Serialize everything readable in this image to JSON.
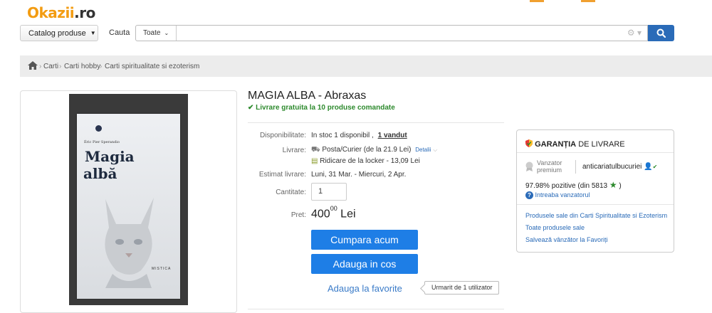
{
  "header": {
    "logo_ok": "Okazii",
    "logo_rest": ".ro",
    "catalog_label": "Catalog produse",
    "search_label": "Cauta",
    "search_category": "Toate",
    "search_value": ""
  },
  "breadcrumb": {
    "items": [
      "Carti",
      "Carti hobby",
      "Carti spiritualitate si ezoterism"
    ]
  },
  "product": {
    "title": "MAGIA ALBA - Abraxas",
    "free_shipping": "Livrare gratuita la 10 produse comandate",
    "availability_label": "Disponibilitate:",
    "availability_value": "In stoc 1 disponibil ,",
    "sold": "1 vandut",
    "delivery_label": "Livrare:",
    "delivery_option1": "Posta/Curier (de la 21.9 Lei)",
    "delivery_details": "Detalii",
    "delivery_option2": "Ridicare de la locker - 13,09 Lei",
    "estimate_label": "Estimat livrare:",
    "estimate_value": "Luni, 31 Mar. - Miercuri, 2 Apr.",
    "quantity_label": "Cantitate:",
    "quantity_value": "1",
    "price_label": "Pret:",
    "price_main": "400",
    "price_cents": "00",
    "price_currency": "Lei",
    "buy_button": "Cumpara acum",
    "cart_button": "Adauga in cos",
    "favorite_link": "Adauga  la favorite",
    "followers": "Urmarit de 1 utilizator"
  },
  "book_cover": {
    "author": "Éric Pier Sperandio",
    "title_line1": "Magia",
    "title_line2": "albă",
    "publisher": "MISTICA"
  },
  "seller": {
    "guarantee_bold": "GARANȚIA",
    "guarantee_rest": "DE LIVRARE",
    "premium_line1": "Vanzator",
    "premium_line2": "premium",
    "username": "anticariatulbucuriei",
    "rating": "97.98% pozitive (din 5813",
    "rating_end": ")",
    "ask": "Intreaba vanzatorul",
    "link1": "Produsele sale din Carti Spiritualitate si Ezoterism",
    "link2": "Toate produsele sale",
    "link3": "Salvează vânzător la Favoriți"
  },
  "colors": {
    "accent_blue": "#1e7ee6",
    "link_blue": "#2a6bb8",
    "success_green": "#2d8a2d",
    "logo_orange": "#f39c12"
  }
}
